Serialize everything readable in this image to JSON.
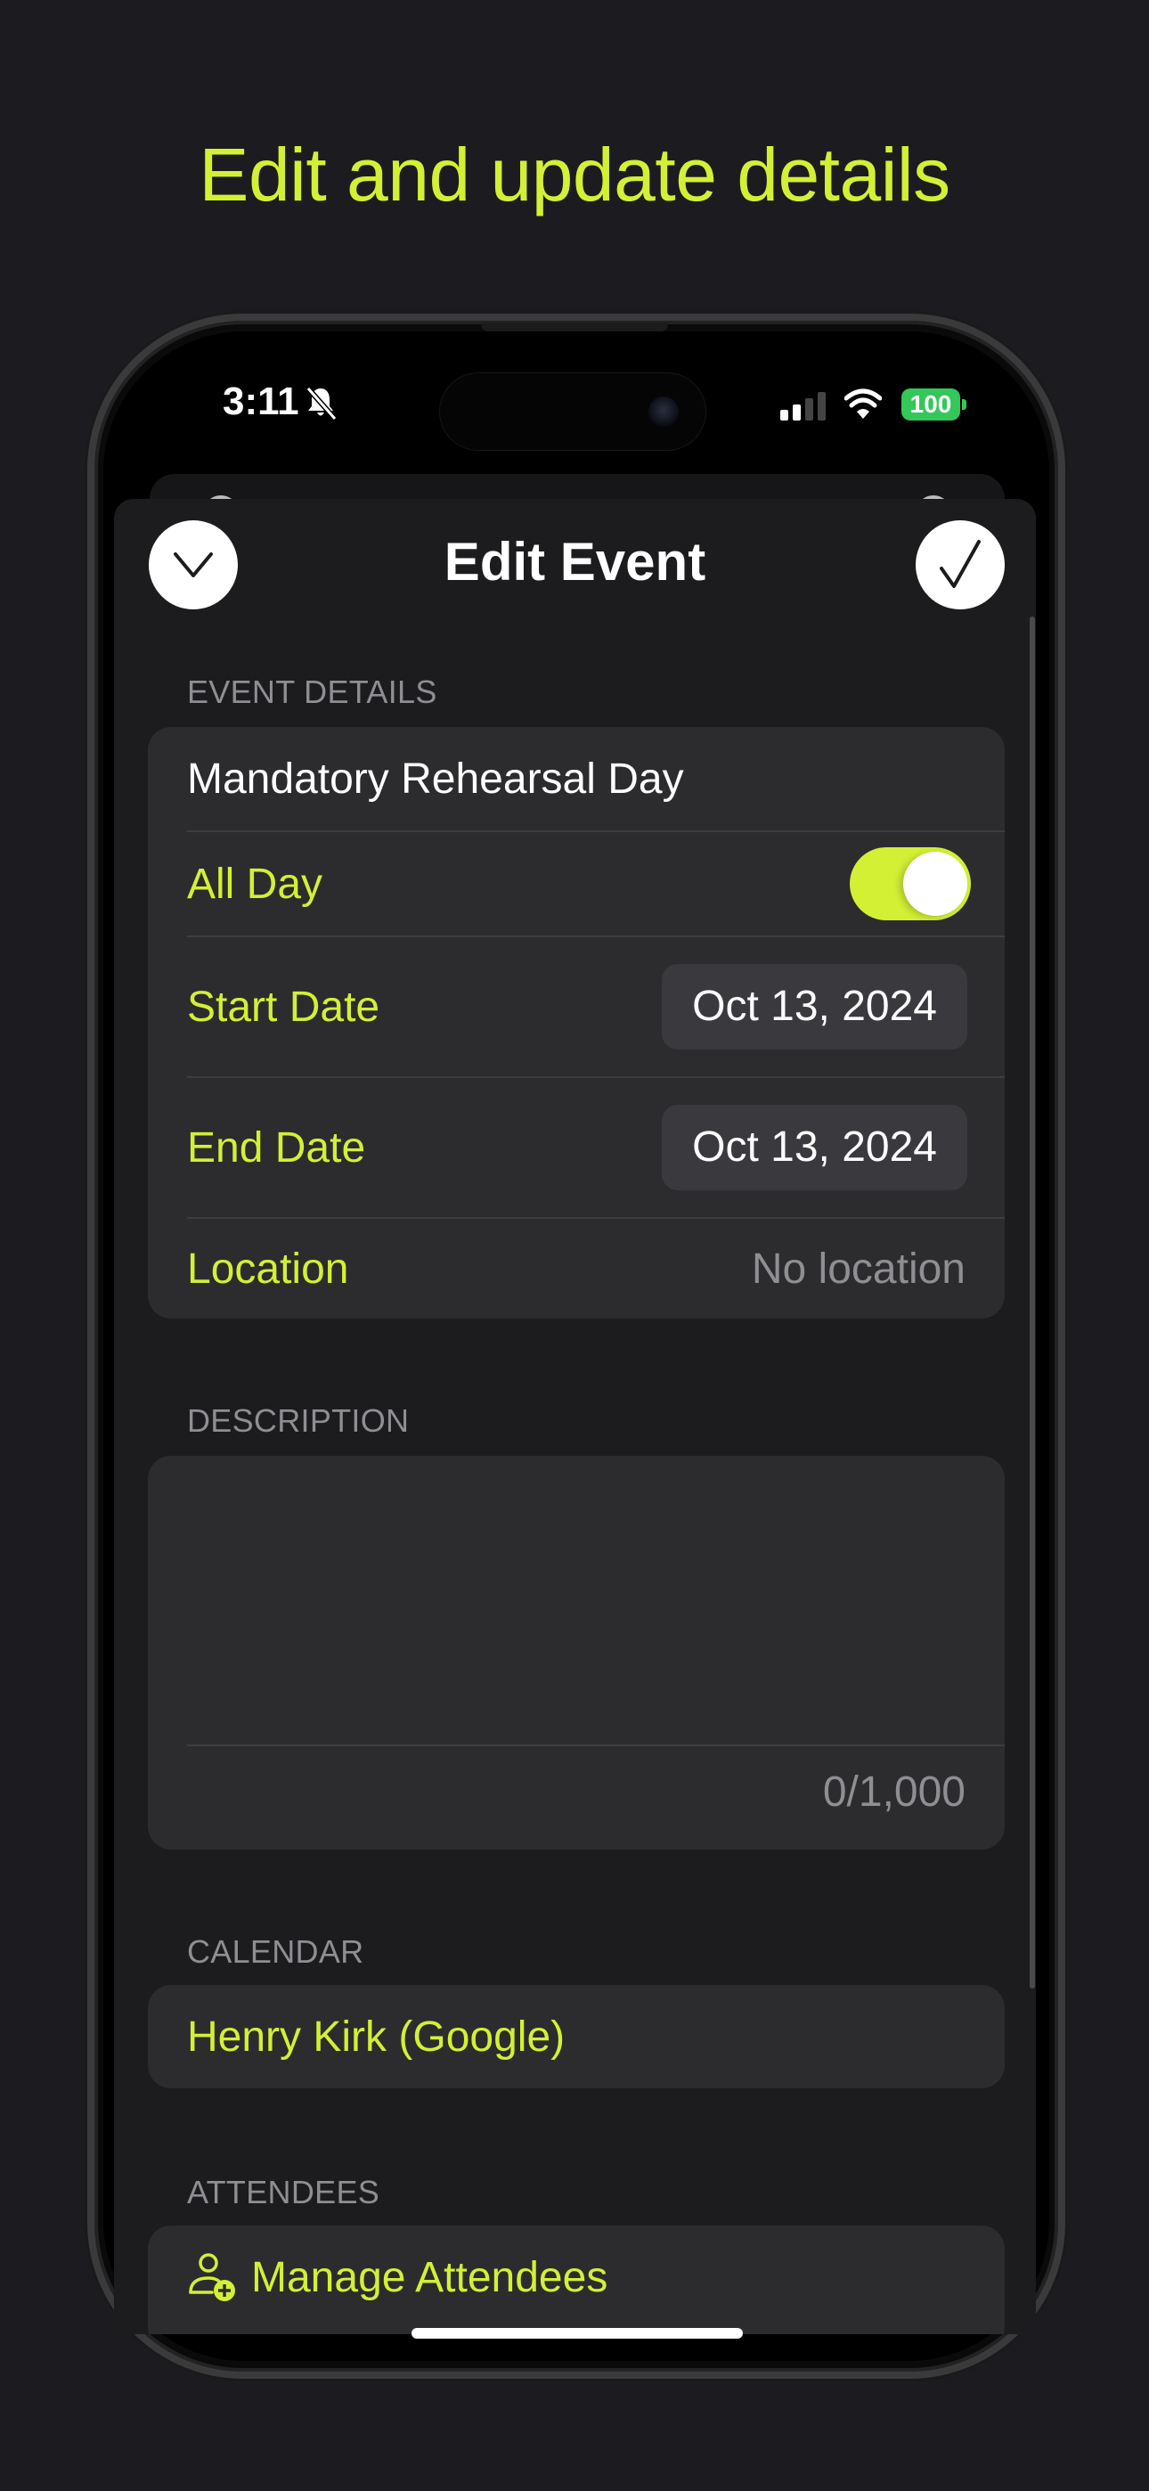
{
  "headline": "Edit and update details",
  "status_bar": {
    "time": "3:11",
    "silent_icon": "bell-slash-icon",
    "signal_icon": "cellular-signal-icon",
    "wifi_icon": "wifi-icon",
    "battery_level": "100",
    "battery_color": "#34c759"
  },
  "header": {
    "title": "Edit Event",
    "dismiss_icon": "chevron-down-icon",
    "confirm_icon": "checkmark-icon"
  },
  "event_details": {
    "section_label": "EVENT DETAILS",
    "title_value": "Mandatory Rehearsal Day",
    "all_day_label": "All Day",
    "all_day_on": true,
    "start_date_label": "Start Date",
    "start_date_value": "Oct 13, 2024",
    "end_date_label": "End Date",
    "end_date_value": "Oct 13, 2024",
    "location_label": "Location",
    "location_placeholder": "No location"
  },
  "description": {
    "section_label": "DESCRIPTION",
    "value": "",
    "char_count": "0/1,000"
  },
  "calendar": {
    "section_label": "CALENDAR",
    "value": "Henry Kirk (Google)"
  },
  "attendees": {
    "section_label": "ATTENDEES",
    "manage_label": "Manage Attendees",
    "icon": "person-add-icon"
  },
  "colors": {
    "accent": "#d4f034",
    "background": "#1c1c20",
    "card": "#2c2c2e",
    "secondary_text": "#8e8e93"
  }
}
